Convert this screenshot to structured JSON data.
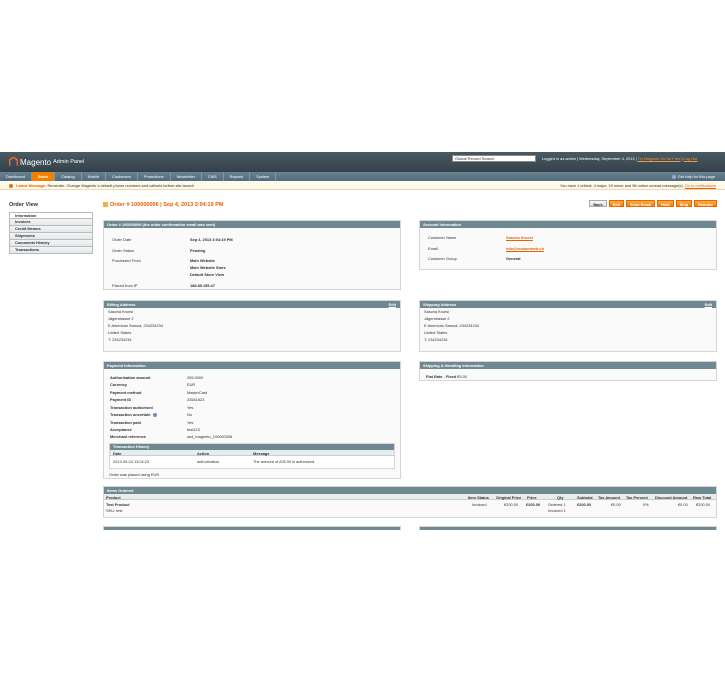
{
  "header": {
    "brand": "Magento",
    "brand_sub": "Admin Panel",
    "search_value": "Global Record Search",
    "user_info": "Logged in as admin | Wednesday, September 4, 2013 |",
    "try_link": "Try Magento Go for Free",
    "logout": "Log Out"
  },
  "nav": {
    "items": [
      "Dashboard",
      "Sales",
      "Catalog",
      "Mobile",
      "Customers",
      "Promotions",
      "Newsletter",
      "CMS",
      "Reports",
      "System"
    ],
    "active": "Sales",
    "help": "Get help for this page"
  },
  "message": {
    "label": "Latest Message:",
    "text": "Reminder: Change Magento`s default phone numbers and callouts before site launch",
    "right": "You have 1 critical, 4 major, 19 minor and 98 notice unread message(s).",
    "right_link": "Go to notifications"
  },
  "sidebar": {
    "title": "Order View",
    "tabs": [
      "Information",
      "Invoices",
      "Credit Memos",
      "Shipments",
      "Comments History",
      "Transactions"
    ]
  },
  "page": {
    "title": "Order # 100000006 | Sep 4, 2013 3:04:19 PM",
    "buttons": [
      "Back",
      "Edit",
      "Send Email",
      "Hold",
      "Ship",
      "Reorder"
    ]
  },
  "order": {
    "header": "Order # 100000006 (the order confirmation email was sent)",
    "labels": [
      "Order Date",
      "Order Status",
      "Purchased From",
      "Placed from IP"
    ],
    "date": "Sep 4, 2013 3:04:19 PM",
    "status": "Pending",
    "store_1": "Main Website",
    "store_2": "Main Website Store",
    "store_3": "Default Store View",
    "ip": "188.85.155.47"
  },
  "account": {
    "header": "Account Information",
    "labels": [
      "Customer Name",
      "Email",
      "Customer Group"
    ],
    "name": "Sascha Kruesi",
    "email": "info@customweb.ch",
    "group": "General"
  },
  "billing": {
    "header": "Billing Address",
    "edit": "Edit",
    "lines": [
      "Sascha Kruesi",
      "Jägerstrasse 2",
      "E American Samoa, 234234234",
      "United States",
      "T: 234234234"
    ]
  },
  "shipping": {
    "header": "Shipping Address",
    "edit": "Edit",
    "lines": [
      "Sascha Kruesi",
      "Jägerstrasse 2",
      "E American Samoa, 234234234",
      "United States",
      "T: 234234234"
    ]
  },
  "payment": {
    "header": "Payment Information",
    "rows": [
      {
        "k": "Authorisation amount",
        "v": "205.0000"
      },
      {
        "k": "Currency",
        "v": "EUR"
      },
      {
        "k": "Payment method",
        "v": "MasterCard"
      },
      {
        "k": "Payment ID",
        "v": "23541623"
      },
      {
        "k": "Transaction authorised",
        "v": "Yes"
      },
      {
        "k": "Transaction uncertain",
        "v": "No"
      },
      {
        "k": "Transaction paid",
        "v": "Yes"
      },
      {
        "k": "Acceptance",
        "v": "test123"
      },
      {
        "k": "Merchant reference",
        "v": "sed_magento_100000006"
      }
    ],
    "history_header": "Transaction History",
    "history_cols": [
      "Date",
      "Action",
      "Message"
    ],
    "history_row": [
      "2013-09-04 13:04:23",
      "authorization",
      "The amount of 205.00 is authorized."
    ],
    "footer": "Order was placed using EUR"
  },
  "shipping_method": {
    "header": "Shipping & Handling Information",
    "label": "Flat Rate - Fixed",
    "price": "€5.00"
  },
  "items": {
    "header": "Items Ordered",
    "cols": [
      "Product",
      "Item Status",
      "Original Price",
      "Price",
      "Qty",
      "Subtotal",
      "Tax Amount",
      "Tax Percent",
      "Discount Amount",
      "Row Total"
    ],
    "product": "Test Product",
    "sku": "SKU: test",
    "status": "Invoiced",
    "orig_price": "€200.00",
    "price": "€200.00",
    "qty_ordered": "Ordered 1",
    "qty_invoiced": "Invoiced 1",
    "subtotal": "€200.00",
    "tax_amount": "€0.00",
    "tax_percent": "0%",
    "discount": "€0.00",
    "row_total": "€200.00"
  }
}
